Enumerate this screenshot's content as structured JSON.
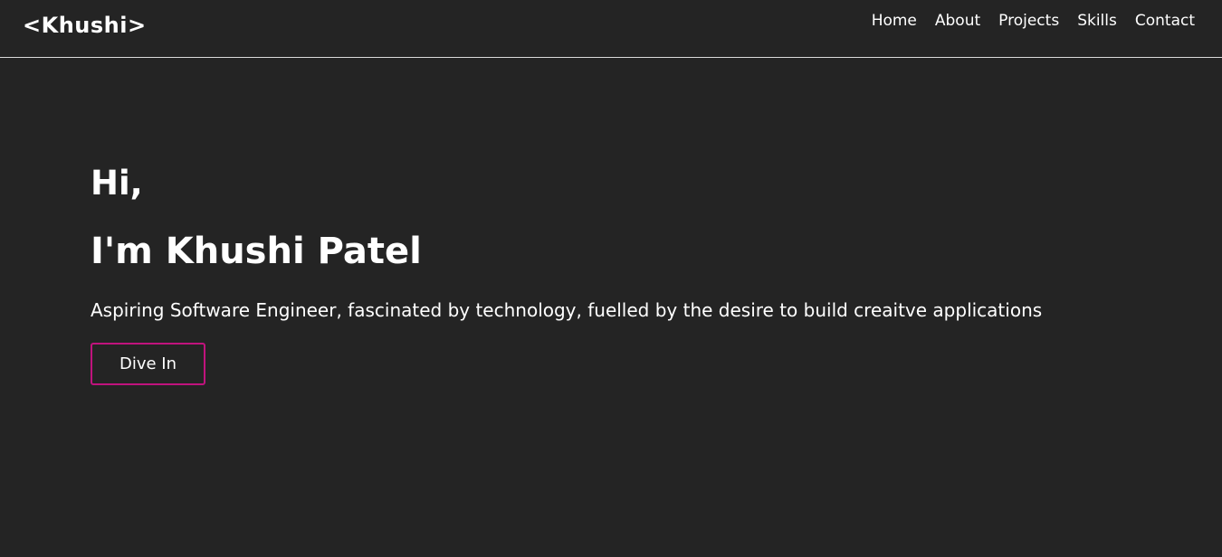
{
  "header": {
    "brand": "<Khushi>",
    "nav": [
      {
        "label": "Home"
      },
      {
        "label": "About"
      },
      {
        "label": "Projects"
      },
      {
        "label": "Skills"
      },
      {
        "label": "Contact"
      }
    ]
  },
  "hero": {
    "greeting": "Hi,",
    "name": "I'm Khushi Patel",
    "tagline": "Aspiring Software Engineer, fascinated by technology, fuelled by the desire to build creaitve applications",
    "cta_label": "Dive In"
  },
  "colors": {
    "background": "#242424",
    "text": "#ffffff",
    "accent": "#c0137d"
  }
}
